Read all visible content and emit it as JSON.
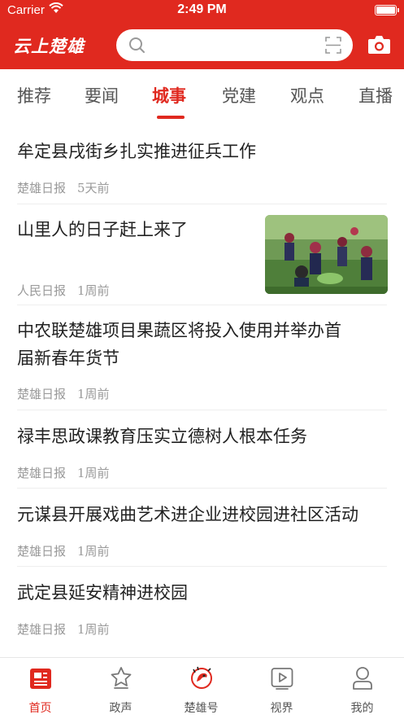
{
  "status_bar": {
    "carrier": "Carrier",
    "time": "2:49 PM"
  },
  "header": {
    "logo": "云上楚雄",
    "search_placeholder": ""
  },
  "tabs": [
    {
      "label": "推荐"
    },
    {
      "label": "要闻"
    },
    {
      "label": "城事",
      "active": true
    },
    {
      "label": "党建"
    },
    {
      "label": "观点"
    },
    {
      "label": "直播"
    }
  ],
  "news": [
    {
      "title": "牟定县戌街乡扎实推进征兵工作",
      "source": "楚雄日报",
      "time": "5天前"
    },
    {
      "title": "山里人的日子赶上来了",
      "source": "人民日报",
      "time": "1周前",
      "has_image": true
    },
    {
      "title": " 中农联楚雄项目果蔬区将投入使用并举办首",
      "title_line2": "届新春年货节",
      "source": "楚雄日报",
      "time": "1周前"
    },
    {
      "title": "禄丰思政课教育压实立德树人根本任务",
      "source": "楚雄日报",
      "time": "1周前"
    },
    {
      "title": "元谋县开展戏曲艺术进企业进校园进社区活动",
      "source": "楚雄日报",
      "time": "1周前"
    },
    {
      "title": "武定县延安精神进校园",
      "source": "楚雄日报",
      "time": "1周前"
    }
  ],
  "bottom_nav": [
    {
      "label": "首页",
      "icon": "news-home-icon",
      "active": true
    },
    {
      "label": "政声",
      "icon": "star-badge-icon"
    },
    {
      "label": "楚雄号",
      "icon": "phoenix-logo-icon"
    },
    {
      "label": "视界",
      "icon": "video-play-icon"
    },
    {
      "label": "我的",
      "icon": "user-profile-icon"
    }
  ],
  "colors": {
    "brand_red": "#e0291f",
    "meta_gray": "#9a9a9a"
  }
}
